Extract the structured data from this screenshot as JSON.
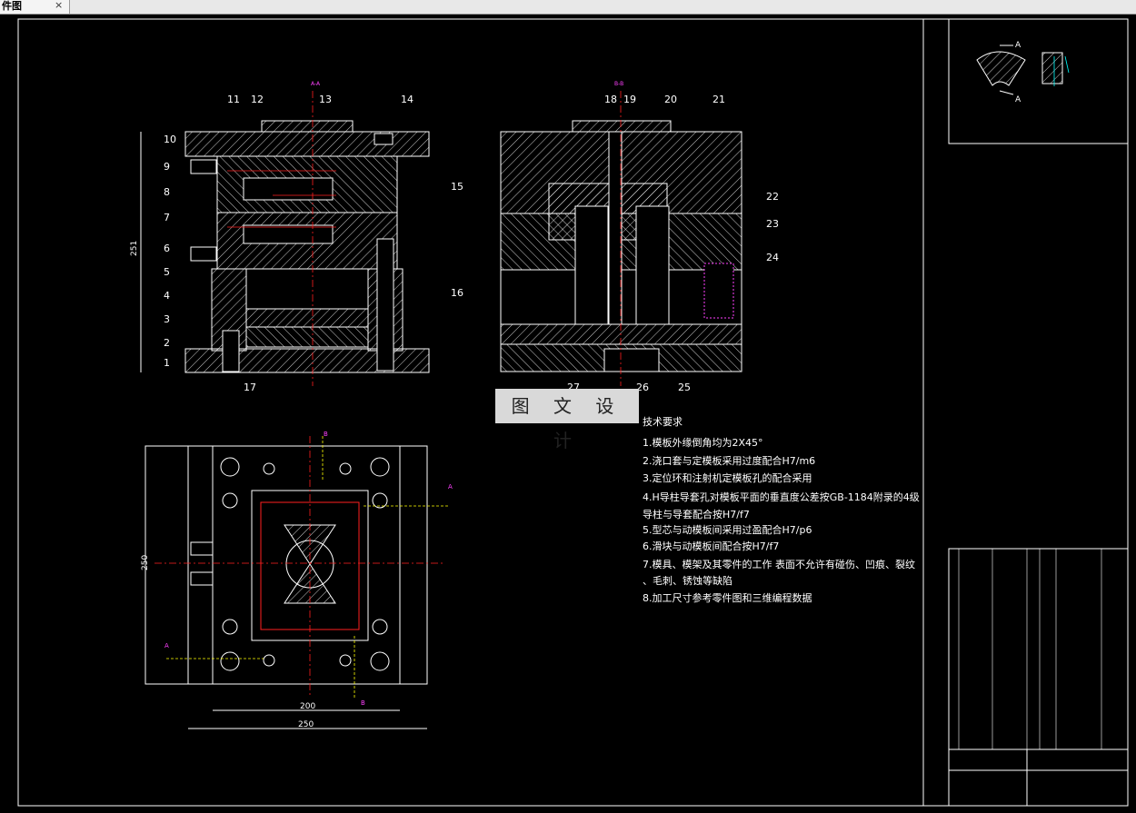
{
  "tab": {
    "label": "件图",
    "close": "×"
  },
  "sections": {
    "aa": "A-A",
    "bb": "B-B"
  },
  "dims": {
    "h_left": "251",
    "w_plan": "250",
    "d200": "200",
    "d250": "250"
  },
  "section_marks": {
    "a": "A",
    "b": "B"
  },
  "detail_labels": {
    "a1": "A",
    "a2": "A"
  },
  "watermark": "图 文 设 计",
  "tech": {
    "title": "技术要求",
    "items": [
      "1.模板外缘倒角均为2X45°",
      "2.浇口套与定模板采用过度配合H7/m6",
      "3.定位环和注射机定模板孔的配合采用",
      "4.H导柱导套孔对模板平面的垂直度公差按GB-1184附录的4级",
      "  导柱与导套配合按H7/f7",
      "5.型芯与动模板间采用过盈配合H7/p6",
      "6.滑块与动模板间配合按H7/f7",
      "7.模具、模架及其零件的工作 表面不允许有碰伤、凹痕、裂纹",
      "、毛刺、锈蚀等缺陷",
      "8.加工尺寸参考零件图和三维编程数据"
    ]
  },
  "callouts_left": [
    "1",
    "2",
    "3",
    "4",
    "5",
    "6",
    "7",
    "8",
    "9",
    "10",
    "11",
    "12",
    "13",
    "14",
    "15",
    "16",
    "17"
  ],
  "callouts_right": [
    "18",
    "19",
    "20",
    "21",
    "22",
    "23",
    "24",
    "25",
    "26",
    "27"
  ],
  "colors": {
    "accent_red": "#ff2020",
    "accent_magenta": "#ff40ff",
    "accent_yellow": "#ffff00",
    "line": "#ffffff"
  }
}
